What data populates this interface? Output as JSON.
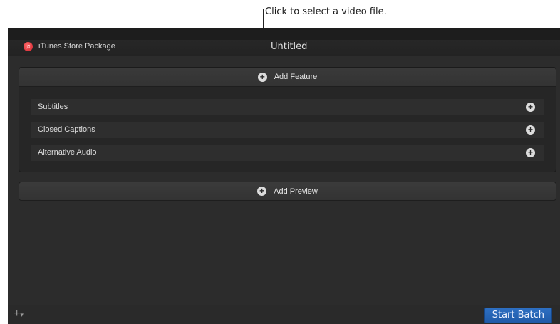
{
  "callout": {
    "text": "Click to select a video file."
  },
  "titlebar": {
    "package_label": "iTunes Store Package",
    "document_title": "Untitled",
    "app_icon": "music-note-icon"
  },
  "feature": {
    "add_label": "Add Feature",
    "items": [
      {
        "label": "Subtitles"
      },
      {
        "label": "Closed Captions"
      },
      {
        "label": "Alternative Audio"
      }
    ]
  },
  "preview": {
    "add_label": "Add Preview"
  },
  "bottom_bar": {
    "add_menu_icon": "plus-icon",
    "start_batch_label": "Start Batch"
  },
  "colors": {
    "accent": "#2468bd",
    "app_icon": "#d01f2a"
  }
}
